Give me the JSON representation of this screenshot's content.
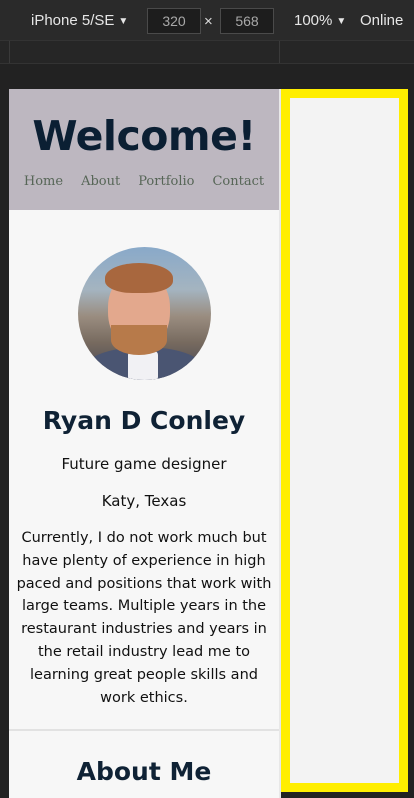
{
  "devtools": {
    "device": "iPhone 5/SE",
    "width": "320",
    "height": "568",
    "times": "×",
    "zoom": "100%",
    "network": "Online"
  },
  "page": {
    "welcome": "Welcome!",
    "nav": [
      "Home",
      "About",
      "Portfolio",
      "Contact"
    ],
    "name": "Ryan D Conley",
    "tagline": "Future game designer",
    "location": "Katy, Texas",
    "bio": "Currently, I do not work much but have plenty of experience in high paced and positions that work with large teams. Multiple years in the restaurant industries and years in the retail industry lead me to learning great people skills and work ethics.",
    "about_heading": "About Me"
  },
  "colors": {
    "highlight": "#ffee00",
    "header_bg": "#bdb7c0",
    "heading_text": "#0b1f33",
    "nav_text": "#576657"
  }
}
